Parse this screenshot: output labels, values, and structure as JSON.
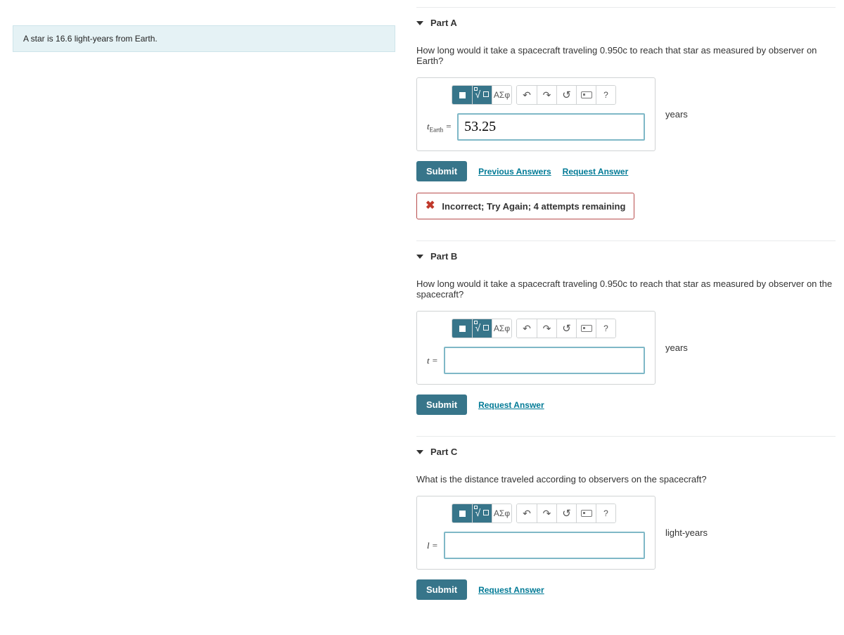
{
  "prompt_text": "A star is 16.6 light-years from Earth.",
  "toolbar": {
    "template_name": "template-icon",
    "math_name": "math-root-icon",
    "greek_label": "ΑΣφ",
    "undo_glyph": "↶",
    "redo_glyph": "↷",
    "reset_glyph": "↺",
    "keyboard_name": "keyboard-icon",
    "help_label": "?"
  },
  "buttons": {
    "submit": "Submit",
    "previous_answers": "Previous Answers",
    "request_answer": "Request Answer"
  },
  "parts": {
    "a": {
      "title": "Part A",
      "question": "How long would it take a spacecraft traveling 0.950c to reach that star as measured by observer on Earth?",
      "var_html": "t<sub>Earth</sub> =",
      "value": "53.25",
      "unit": "years",
      "feedback": "Incorrect; Try Again; 4 attempts remaining"
    },
    "b": {
      "title": "Part B",
      "question": "How long would it take a spacecraft traveling 0.950c to reach that star as measured by observer on the spacecraft?",
      "var_html": "t =",
      "value": "",
      "unit": "years"
    },
    "c": {
      "title": "Part C",
      "question": "What is the distance traveled according to observers on the spacecraft?",
      "var_html": "l =",
      "value": "",
      "unit": "light-years"
    }
  }
}
